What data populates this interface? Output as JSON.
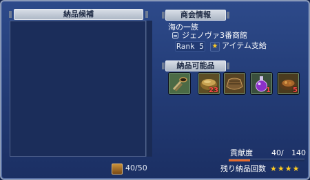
{
  "candidates": {
    "title": "納品候補",
    "count_current": "40",
    "count_max": "50",
    "count_text": "40/50"
  },
  "shop_info": {
    "title": "商会情報",
    "guild_name": "海の一族",
    "shop_name": "ジェノヴァ3番商館",
    "rank": "Rank 5",
    "rank_value": 5,
    "support": "アイテム支給"
  },
  "items": {
    "title": "納品可能品",
    "slots": [
      {
        "icon": "tongs-icon",
        "count": ""
      },
      {
        "icon": "grain-bowl-icon",
        "count": "23"
      },
      {
        "icon": "ship-hull-icon",
        "count": ""
      },
      {
        "icon": "potion-flask-icon",
        "count": "1"
      },
      {
        "icon": "food-plate-icon",
        "count": "5"
      }
    ]
  },
  "contribution": {
    "label": "貢献度",
    "current": "40/",
    "max": "140",
    "fraction": 0.286
  },
  "remaining": {
    "label": "残り納品回数",
    "stars": "★★★★",
    "star_count": 4
  },
  "colors": {
    "window_bg": "#243d78",
    "star": "#ffcc22",
    "count_badge": "#ff4747",
    "progress_fill": "#e86b2b"
  }
}
